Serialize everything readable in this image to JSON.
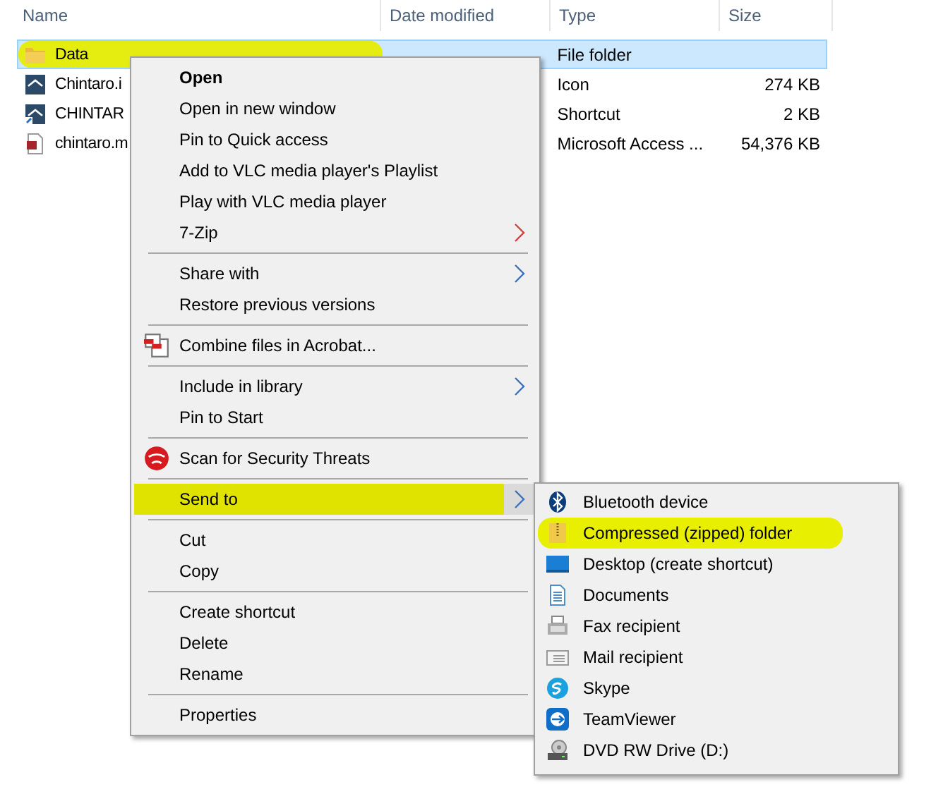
{
  "file_list": {
    "columns": [
      "Name",
      "Date modified",
      "Type",
      "Size"
    ],
    "rows": [
      {
        "name": "Data",
        "type": "File folder",
        "size": "",
        "selected": true,
        "highlighted": true
      },
      {
        "name": "Chintaro.i",
        "type": "Icon",
        "size": "274 KB",
        "selected": false,
        "highlighted": false
      },
      {
        "name": "CHINTAR",
        "type": "Shortcut",
        "size": "2 KB",
        "selected": false,
        "highlighted": false
      },
      {
        "name": "chintaro.m",
        "type": "Microsoft Access ...",
        "size": "54,376 KB",
        "selected": false,
        "highlighted": false
      }
    ]
  },
  "context_menu": {
    "items": [
      {
        "kind": "item",
        "label": "Open",
        "bold": true,
        "submenu": false,
        "selected": false,
        "highlighted": false
      },
      {
        "kind": "item",
        "label": "Open in new window",
        "bold": false,
        "submenu": false,
        "selected": false,
        "highlighted": false
      },
      {
        "kind": "item",
        "label": "Pin to Quick access",
        "bold": false,
        "submenu": false,
        "selected": false,
        "highlighted": false
      },
      {
        "kind": "item",
        "label": "Add to VLC media player's Playlist",
        "bold": false,
        "submenu": false,
        "selected": false,
        "highlighted": false
      },
      {
        "kind": "item",
        "label": "Play with VLC media player",
        "bold": false,
        "submenu": false,
        "selected": false,
        "highlighted": false
      },
      {
        "kind": "item",
        "label": "7-Zip",
        "bold": false,
        "submenu": true,
        "selected": false,
        "highlighted": false
      },
      {
        "kind": "separator"
      },
      {
        "kind": "item",
        "label": "Share with",
        "bold": false,
        "submenu": true,
        "selected": false,
        "highlighted": false
      },
      {
        "kind": "item",
        "label": "Restore previous versions",
        "bold": false,
        "submenu": false,
        "selected": false,
        "highlighted": false
      },
      {
        "kind": "separator"
      },
      {
        "kind": "item",
        "label": "Combine files in Acrobat...",
        "bold": false,
        "submenu": false,
        "selected": false,
        "highlighted": false
      },
      {
        "kind": "separator"
      },
      {
        "kind": "item",
        "label": "Include in library",
        "bold": false,
        "submenu": true,
        "selected": false,
        "highlighted": false
      },
      {
        "kind": "item",
        "label": "Pin to Start",
        "bold": false,
        "submenu": false,
        "selected": false,
        "highlighted": false
      },
      {
        "kind": "separator"
      },
      {
        "kind": "item",
        "label": "Scan for Security Threats",
        "bold": false,
        "submenu": false,
        "selected": false,
        "highlighted": false
      },
      {
        "kind": "separator"
      },
      {
        "kind": "item",
        "label": "Send to",
        "bold": false,
        "submenu": true,
        "selected": true,
        "highlighted": true
      },
      {
        "kind": "separator"
      },
      {
        "kind": "item",
        "label": "Cut",
        "bold": false,
        "submenu": false,
        "selected": false,
        "highlighted": false
      },
      {
        "kind": "item",
        "label": "Copy",
        "bold": false,
        "submenu": false,
        "selected": false,
        "highlighted": false
      },
      {
        "kind": "separator"
      },
      {
        "kind": "item",
        "label": "Create shortcut",
        "bold": false,
        "submenu": false,
        "selected": false,
        "highlighted": false
      },
      {
        "kind": "item",
        "label": "Delete",
        "bold": false,
        "submenu": false,
        "selected": false,
        "highlighted": false
      },
      {
        "kind": "item",
        "label": "Rename",
        "bold": false,
        "submenu": false,
        "selected": false,
        "highlighted": false
      },
      {
        "kind": "separator"
      },
      {
        "kind": "item",
        "label": "Properties",
        "bold": false,
        "submenu": false,
        "selected": false,
        "highlighted": false
      }
    ]
  },
  "send_to_menu": {
    "items": [
      {
        "label": "Bluetooth device",
        "highlighted": false
      },
      {
        "label": "Compressed (zipped) folder",
        "highlighted": true
      },
      {
        "label": "Desktop (create shortcut)",
        "highlighted": false
      },
      {
        "label": "Documents",
        "highlighted": false
      },
      {
        "label": "Fax recipient",
        "highlighted": false
      },
      {
        "label": "Mail recipient",
        "highlighted": false
      },
      {
        "label": "Skype",
        "highlighted": false
      },
      {
        "label": "TeamViewer",
        "highlighted": false
      },
      {
        "label": "DVD RW Drive (D:)",
        "highlighted": false
      }
    ]
  }
}
